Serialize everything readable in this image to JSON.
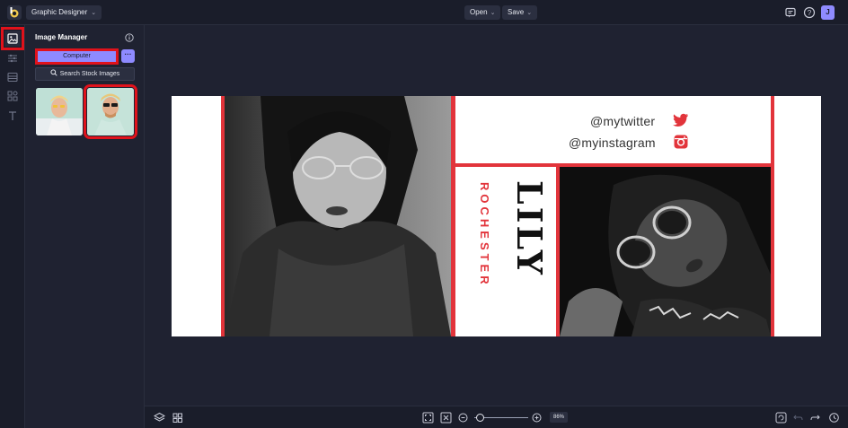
{
  "topbar": {
    "app_name": "Graphic Designer",
    "open_label": "Open",
    "save_label": "Save",
    "avatar_initial": "J"
  },
  "panel": {
    "title": "Image Manager",
    "computer_label": "Computer",
    "more_label": "···",
    "stock_label": "Search Stock Images"
  },
  "design": {
    "twitter_handle": "@mytwitter",
    "instagram_handle": "@myinstagram",
    "first_name": "LILY",
    "last_name": "ROCHESTER"
  },
  "zoom": {
    "value_label": "86%",
    "level": 0.1
  },
  "colors": {
    "accent": "#8e8aff",
    "highlight": "#e0121b",
    "brand_red": "#e2343b"
  }
}
